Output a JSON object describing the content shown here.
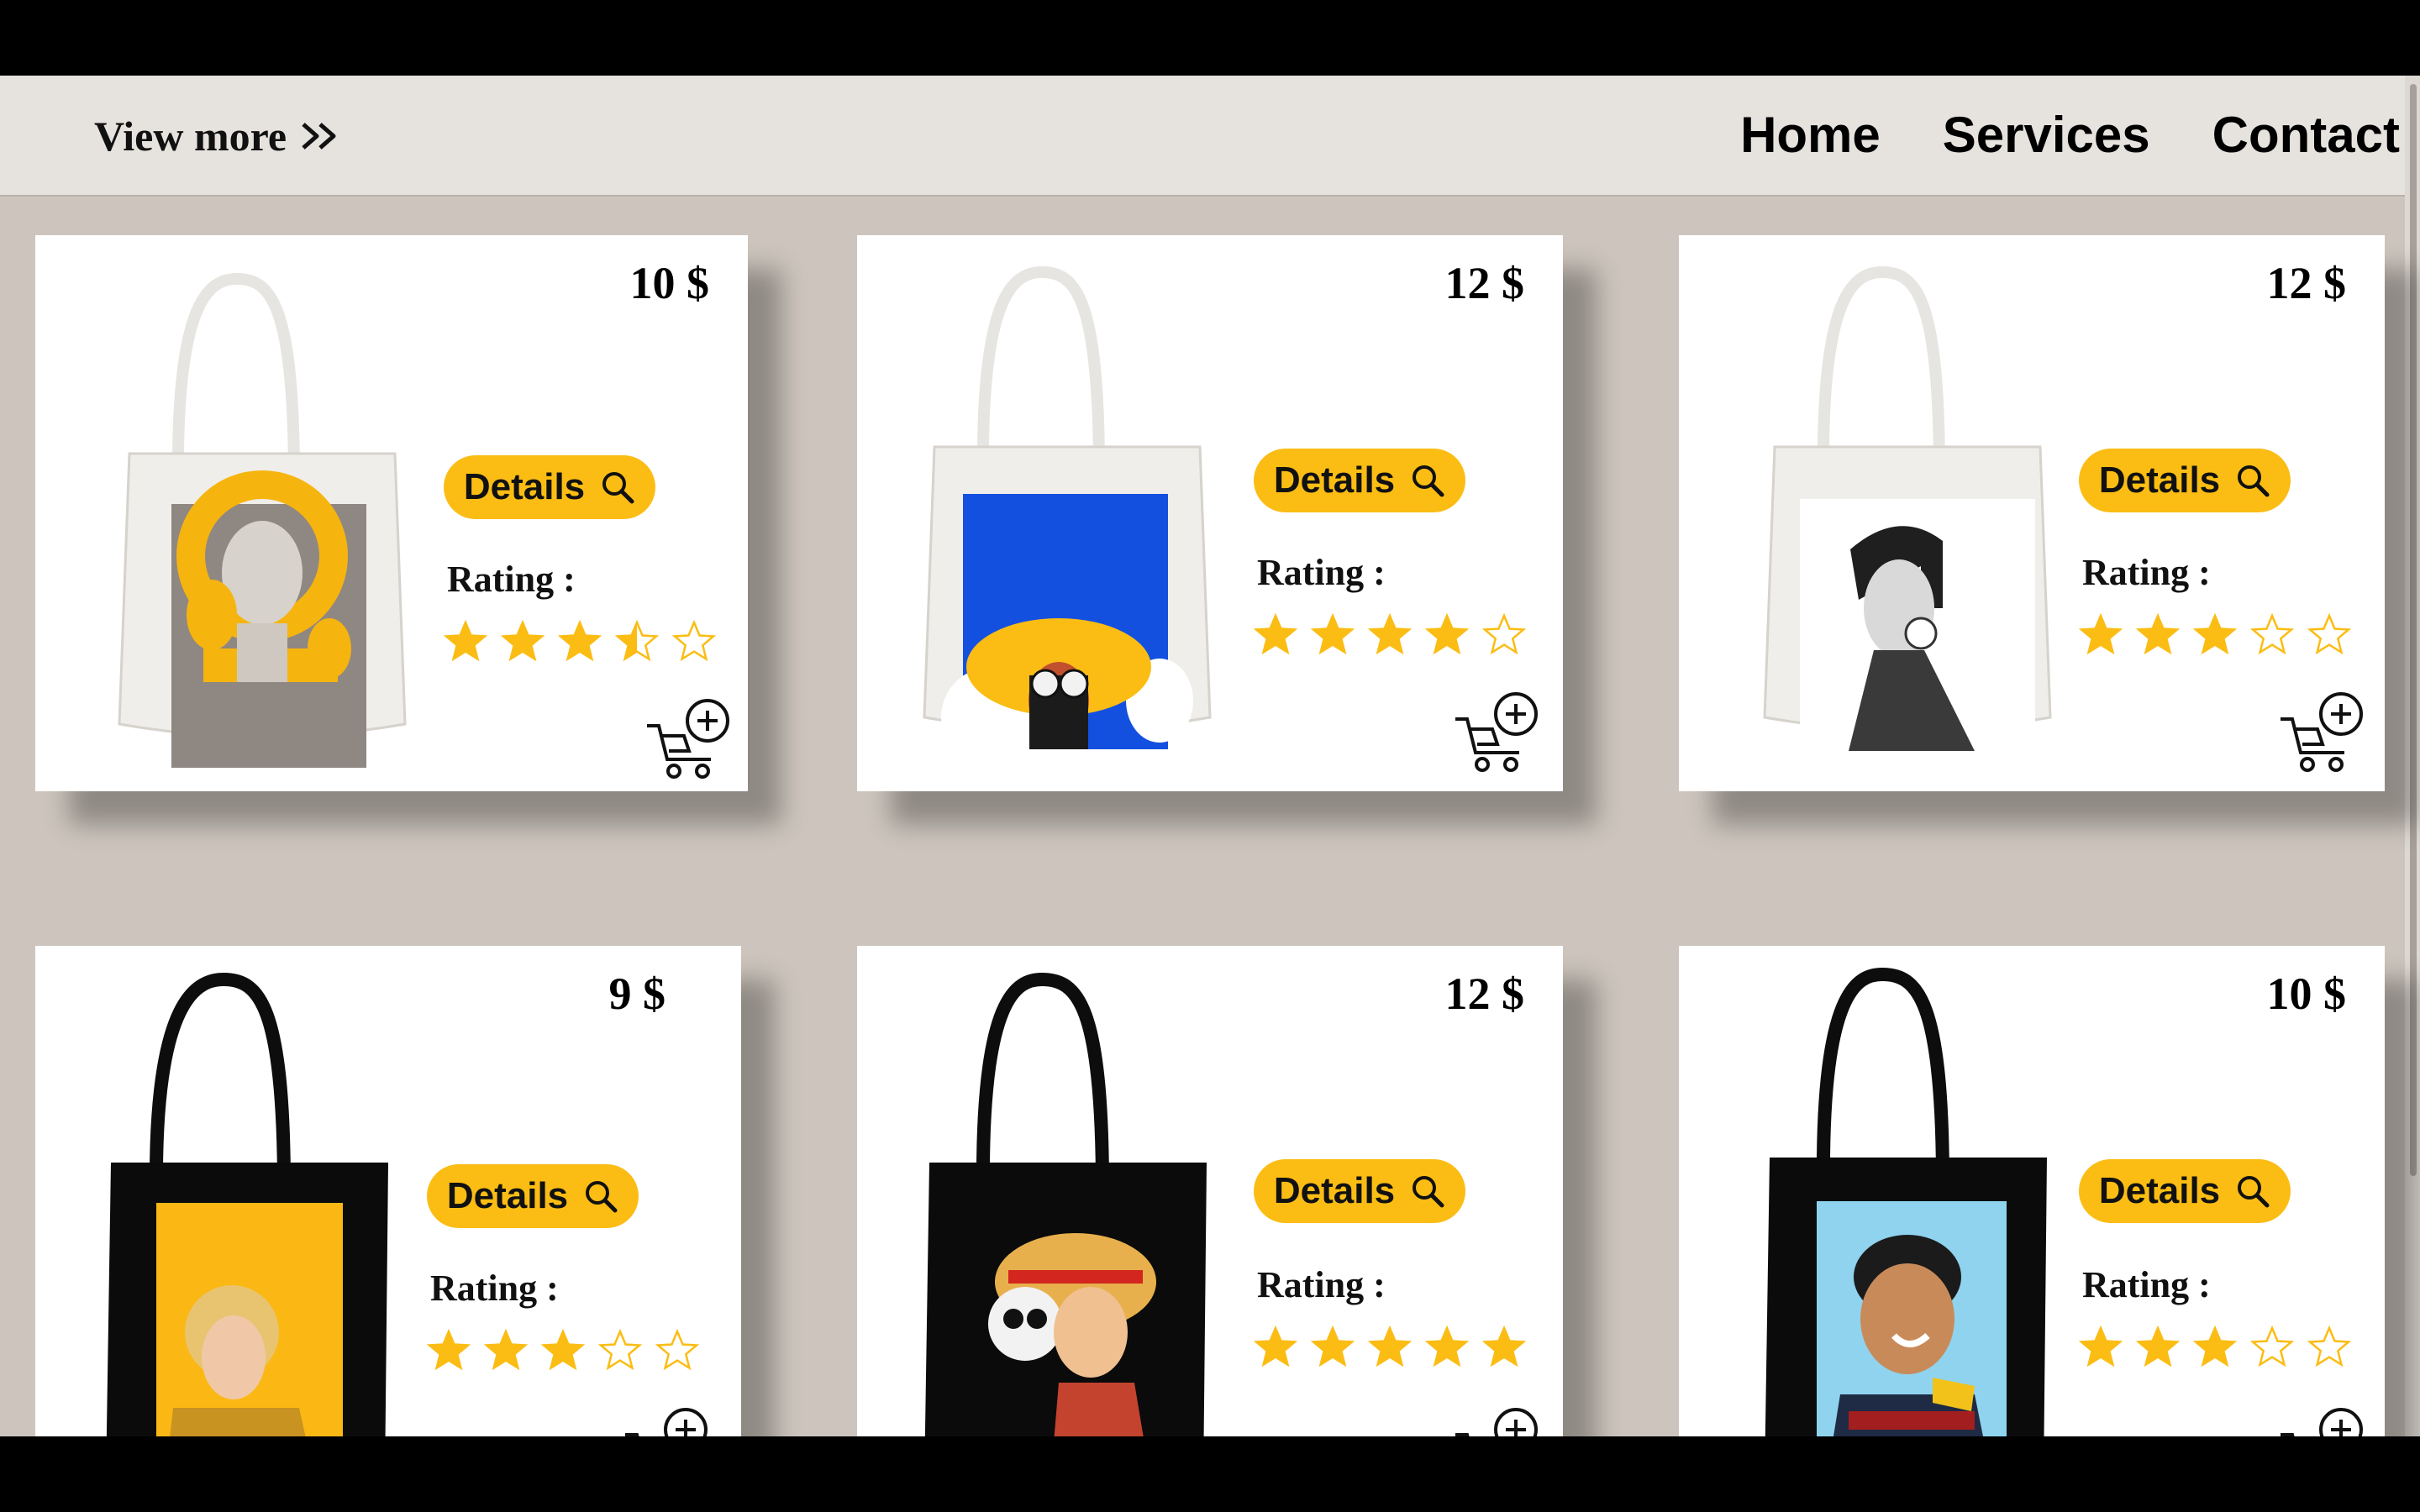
{
  "header": {
    "view_more_label": "View more",
    "nav": {
      "home": "Home",
      "services": "Services",
      "contact": "Contact"
    }
  },
  "common": {
    "details_label": "Details",
    "rating_label": "Rating :"
  },
  "colors": {
    "accent": "#fbbd14",
    "background": "#cdc5bd",
    "topbar": "#e6e2de",
    "card": "#ffffff"
  },
  "products": [
    {
      "price": "10 $",
      "rating": 3.5,
      "bag_color": "white",
      "print": "woman-with-yellow-birds"
    },
    {
      "price": "12 $",
      "rating": 4,
      "bag_color": "white",
      "print": "woman-in-yellow-sunhat"
    },
    {
      "price": "12 $",
      "rating": 3,
      "bag_color": "white",
      "print": "girl-with-headphones-profile"
    },
    {
      "price": "9 $",
      "rating": 3,
      "bag_color": "black",
      "print": "blonde-woman-yellow-background"
    },
    {
      "price": "12 $",
      "rating": 5,
      "bag_color": "black",
      "print": "straw-hat-pirate"
    },
    {
      "price": "10 $",
      "rating": 3,
      "bag_color": "black",
      "print": "smiling-boy-blue-background"
    }
  ]
}
